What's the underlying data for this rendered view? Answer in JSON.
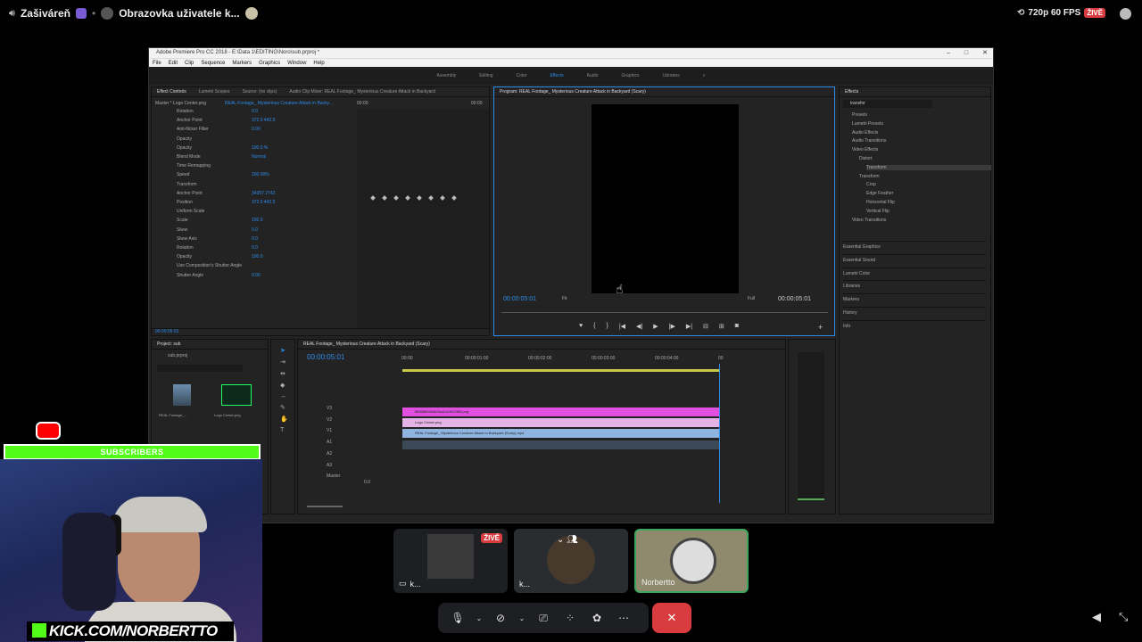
{
  "discord": {
    "channel": "Zašiváreň",
    "stream_title": "Obrazovka uživatele k...",
    "quality": "720p 60 FPS",
    "live_badge": "ŽIVĚ"
  },
  "premiere": {
    "title": "Adobe Premiere Pro CC 2018 - E:\\Data 1\\EDITING\\Noro\\sub.prproj *",
    "menu": [
      "File",
      "Edit",
      "Clip",
      "Sequence",
      "Markers",
      "Graphics",
      "Window",
      "Help"
    ],
    "workspaces": [
      "Assembly",
      "Editing",
      "Color",
      "Effects",
      "Audio",
      "Graphics",
      "Libraries"
    ],
    "active_workspace": "Effects",
    "effect_controls": {
      "tabs": [
        "Effect Controls",
        "Lumetri Scopes",
        "Source: (no clips)",
        "Audio Clip Mixer: REAL Footage_ Mysterious Creature Attack in Backyard"
      ],
      "master": "Master * Logo Center.png",
      "clip": "REAL Footage_ Mysterious Creature Attack in Backy...",
      "tc_start": "00:00",
      "tc_end": "00:00",
      "rows": [
        {
          "label": "Rotation",
          "value": "0.0"
        },
        {
          "label": "Anchor Point",
          "value": "372.0    442.5"
        },
        {
          "label": "Anti-flicker Filter",
          "value": "0.00"
        },
        {
          "label": "Opacity",
          "value": ""
        },
        {
          "label": "Opacity",
          "value": "100.0 %"
        },
        {
          "label": "Blend Mode",
          "value": "Normal"
        },
        {
          "label": "Time Remapping",
          "value": ""
        },
        {
          "label": "Speed",
          "value": "100.00%"
        },
        {
          "label": "Transform",
          "value": ""
        },
        {
          "label": "Anchor Point",
          "value": "34357    2742"
        },
        {
          "label": "Position",
          "value": "372.0    442.5"
        },
        {
          "label": "Uniform Scale",
          "value": ""
        },
        {
          "label": "Scale",
          "value": "100.0"
        },
        {
          "label": "Skew",
          "value": "0.0"
        },
        {
          "label": "Skew Axis",
          "value": "0.0"
        },
        {
          "label": "Rotation",
          "value": "0.0"
        },
        {
          "label": "Opacity",
          "value": "100.0"
        },
        {
          "label": "Use Composition's Shutter Angle",
          "value": ""
        },
        {
          "label": "Shutter Angle",
          "value": "0.00"
        }
      ],
      "timecode": "00:00:05:01"
    },
    "program": {
      "title": "Program: REAL Footage_ Mysterious Creature Attack in Backyard (Scary)",
      "timecode_left": "00:00:05:01",
      "fit": "Fit",
      "full": "Full",
      "timecode_right": "00:00:05:01"
    },
    "effects_panel": {
      "title": "Effects",
      "search": "transfor",
      "tree": [
        "Presets",
        "Lumetri Presets",
        "Audio Effects",
        "Audio Transitions",
        "Video Effects",
        "Distort",
        "Transform",
        "Transform",
        "Crop",
        "Edge Feather",
        "Horizontal Flip",
        "Vertical Flip",
        "Video Transitions"
      ],
      "sections": [
        "Essential Graphics",
        "Essential Sound",
        "Lumetri Color",
        "Libraries",
        "Markers",
        "History",
        "Info"
      ]
    },
    "project": {
      "title": "Project: sub",
      "file": "sub.prproj",
      "items": [
        "REAL Footage_...",
        "Logo Center.png"
      ]
    },
    "timeline": {
      "tab": "REAL Footage_ Mysterious Creature Attack in Backyard (Scary)",
      "timecode": "00:00:05:01",
      "ruler": [
        "00:00",
        "00:00:01:00",
        "00:00:02:00",
        "00:00:03:00",
        "00:00:04:00",
        "00"
      ],
      "tracks": [
        "V3",
        "V2",
        "V1",
        "A1",
        "A2",
        "A3",
        "Master"
      ],
      "clips": [
        {
          "name": "f8068f89264bf3a4241f0228f5.png",
          "color": "#e14fe1"
        },
        {
          "name": "Logo Center.png",
          "color": "#e6b3e6"
        },
        {
          "name": "REAL Footage_ Mysterious Creature Attack in Backyard (Scary).mp4",
          "color": "#8fb4e0"
        }
      ],
      "master_value": "0.0"
    }
  },
  "tiles": [
    {
      "label": "k...",
      "live": "ŽIVĚ"
    },
    {
      "label": "k..."
    },
    {
      "label": "Norbertto"
    }
  ],
  "overlay": {
    "subscribers": "SUBSCRIBERS",
    "kick": "KICK.COM/NORBERTTO"
  }
}
